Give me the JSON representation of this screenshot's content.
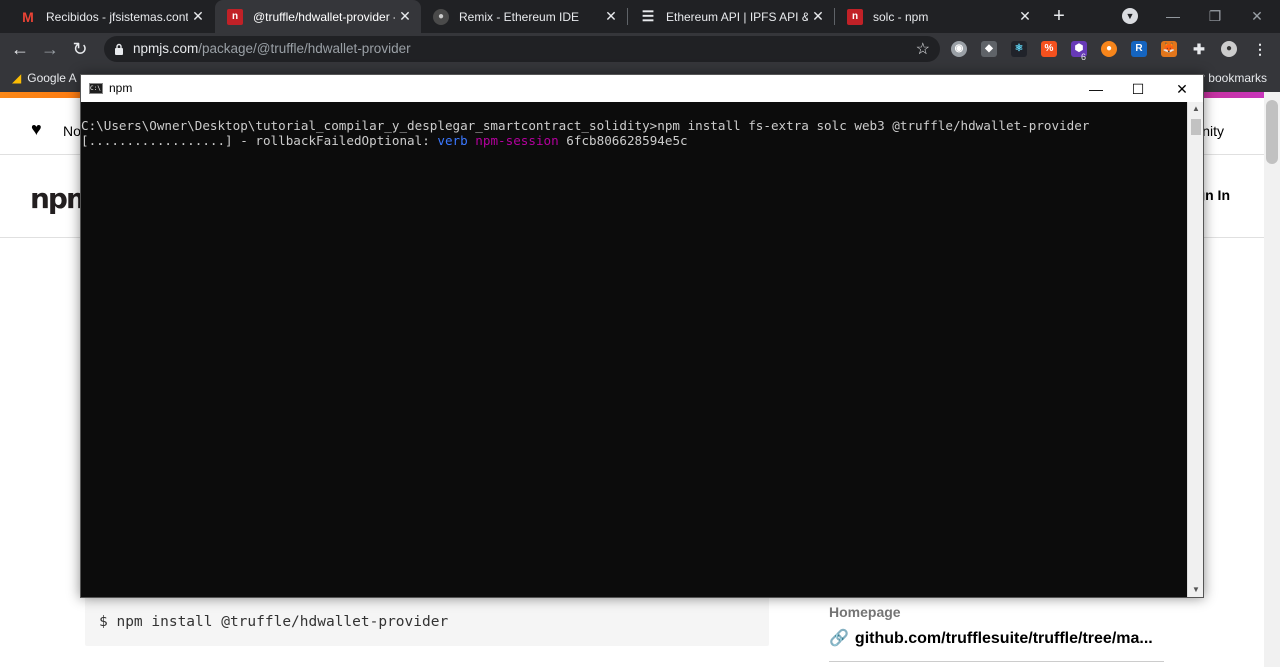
{
  "browser": {
    "tabs": [
      {
        "title": "Recibidos - jfsistemas.contact",
        "favicon": "gmail-icon",
        "active": false
      },
      {
        "title": "@truffle/hdwallet-provider - ",
        "favicon": "npm-icon",
        "active": true
      },
      {
        "title": "Remix - Ethereum IDE",
        "favicon": "remix-icon",
        "active": false
      },
      {
        "title": "Ethereum API | IPFS API & Ga",
        "favicon": "infura-icon",
        "active": false
      },
      {
        "title": "solc - npm",
        "favicon": "npm-icon",
        "active": false
      }
    ],
    "url_host": "npmjs.com",
    "url_path": "/package/@truffle/hdwallet-provider",
    "bookmarks": {
      "left": "Google A",
      "right": "r bookmarks"
    },
    "extension_badge": "6"
  },
  "npm_page": {
    "nav_left": "No",
    "nav_right": "nity",
    "logo": "npm",
    "signin": "gn In",
    "install_command": "$ npm install @truffle/hdwallet-provider",
    "homepage_label": "Homepage",
    "homepage_link": "github.com/trufflesuite/truffle/tree/ma..."
  },
  "console": {
    "title": "npm",
    "line1": "C:\\Users\\Owner\\Desktop\\tutorial_compilar_y_desplegar_smartcontract_solidity>npm install fs-extra solc web3 @truffle/hdwallet-provider",
    "line2_progress": "[..................] - rollbackFailedOptional: ",
    "line2_verb": "verb",
    "line2_session": "npm-session",
    "line2_id": "6fcb806628594e5c"
  },
  "colors": {
    "console_bg": "#0c0c0c",
    "console_text": "#cccccc",
    "verb": "#3b78ff",
    "session": "#b4009e",
    "chrome_dark": "#202124"
  }
}
